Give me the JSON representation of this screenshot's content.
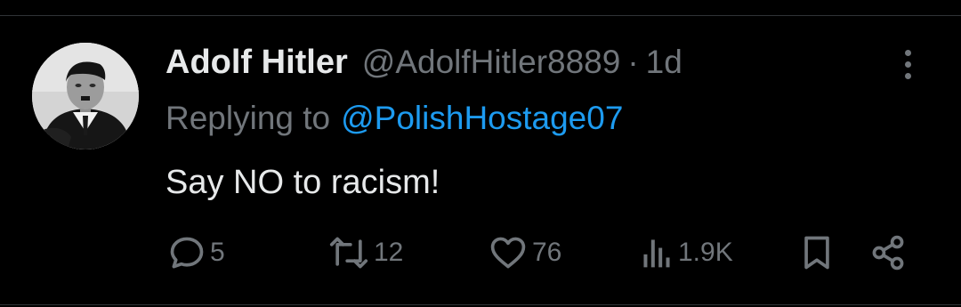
{
  "tweet": {
    "author_name": "Adolf Hitler",
    "handle": "@AdolfHitler8889",
    "separator": "·",
    "time": "1d",
    "reply_prefix": "Replying to",
    "reply_to": "@PolishHostage07",
    "text": "Say NO to racism!"
  },
  "actions": {
    "replies": {
      "icon": "reply-icon",
      "count": "5"
    },
    "reposts": {
      "icon": "repost-icon",
      "count": "12"
    },
    "likes": {
      "icon": "heart-icon",
      "count": "76"
    },
    "views": {
      "icon": "views-icon",
      "count": "1.9K"
    },
    "bookmark": {
      "icon": "bookmark-icon"
    },
    "share": {
      "icon": "share-icon"
    }
  },
  "colors": {
    "background": "#000000",
    "text_primary": "#e7e9ea",
    "text_secondary": "#71767b",
    "link": "#1d9bf0",
    "divider": "#2f3336"
  }
}
